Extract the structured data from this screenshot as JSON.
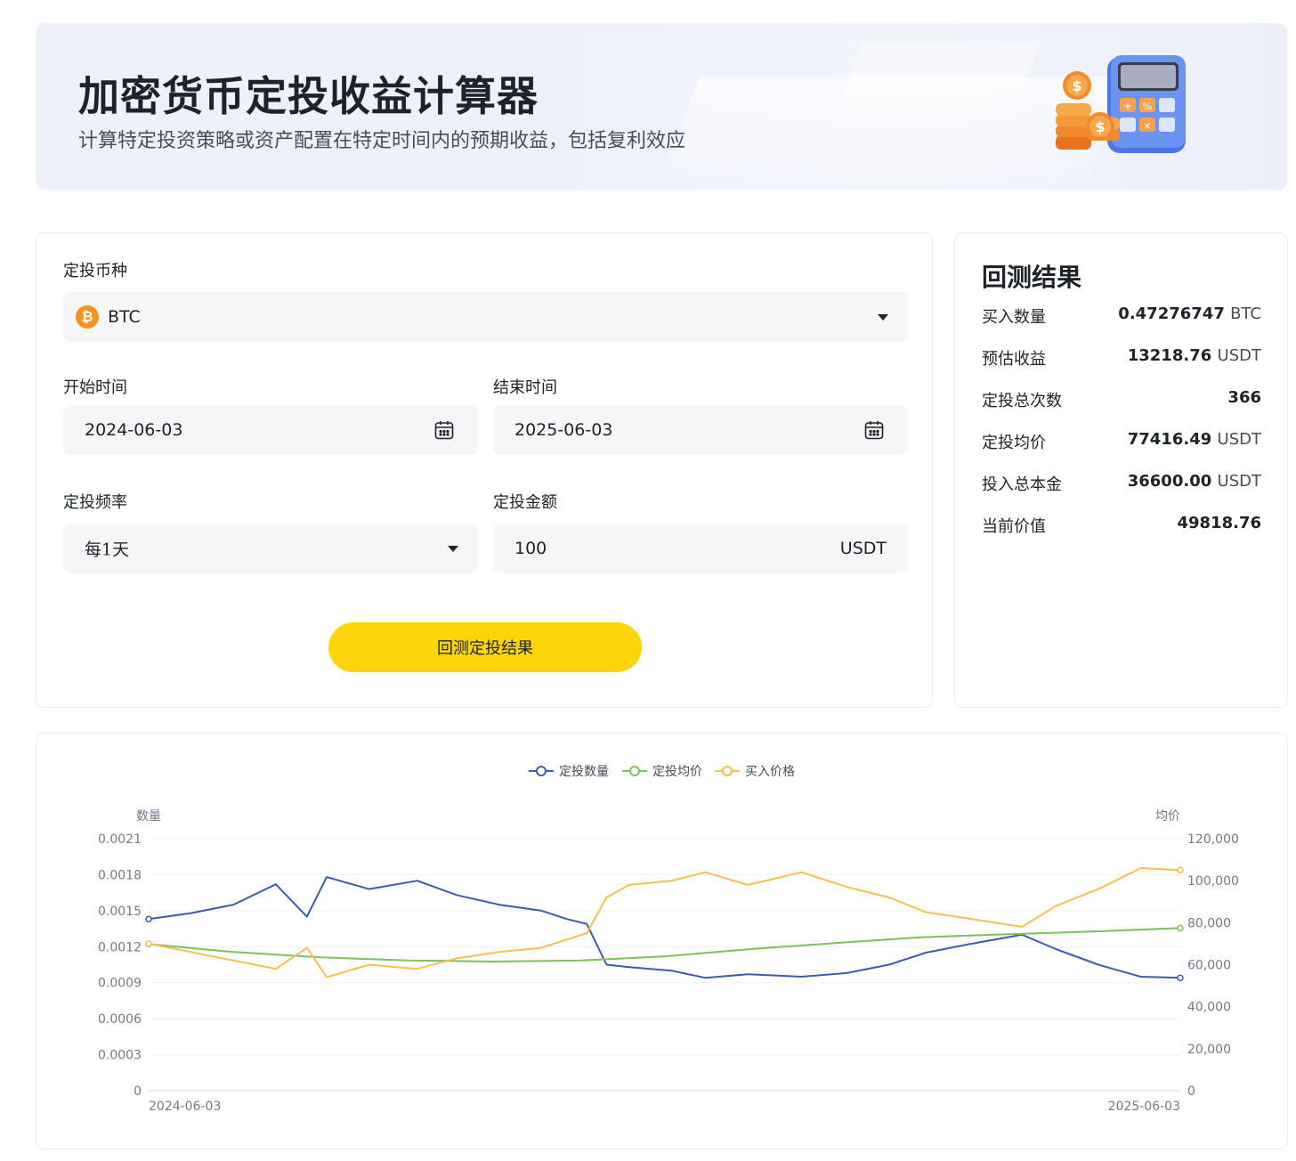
{
  "banner": {
    "title": "加密货币定投收益计算器",
    "subtitle": "计算特定投资策略或资产配置在特定时间内的预期收益，包括复利效应"
  },
  "form": {
    "coin_label": "定投币种",
    "coin_value": "BTC",
    "coin_icon_glyph": "₿",
    "start_label": "开始时间",
    "start_value": "2024-06-03",
    "end_label": "结束时间",
    "end_value": "2025-06-03",
    "freq_label": "定投频率",
    "freq_value": "每1天",
    "amount_label": "定投金额",
    "amount_value": "100",
    "amount_unit": "USDT",
    "submit_label": "回测定投结果"
  },
  "results": {
    "title": "回测结果",
    "rows": [
      {
        "key": "买入数量",
        "value": "0.47276747",
        "unit": "BTC"
      },
      {
        "key": "预估收益",
        "value": "13218.76",
        "unit": "USDT"
      },
      {
        "key": "定投总次数",
        "value": "366",
        "unit": ""
      },
      {
        "key": "定投均价",
        "value": "77416.49",
        "unit": "USDT"
      },
      {
        "key": "投入总本金",
        "value": "36600.00",
        "unit": "USDT"
      },
      {
        "key": "当前价值",
        "value": "49818.76",
        "unit": ""
      }
    ]
  },
  "colors": {
    "accent_yellow": "#fcd50a",
    "btc_orange": "#f7931a",
    "series_quantity": "#3e5bad",
    "series_avg": "#7ec05f",
    "series_price": "#f2c14e"
  },
  "chart_data": {
    "type": "line",
    "legend_position": "top-center",
    "grid": true,
    "y_left_label": "数量",
    "y_right_label": "均价",
    "y_left_ticks": [
      "0",
      "0.0003",
      "0.0006",
      "0.0009",
      "0.0012",
      "0.0015",
      "0.0018",
      "0.0021"
    ],
    "y_right_ticks": [
      "0",
      "20,000",
      "40,000",
      "60,000",
      "80,000",
      "100,000",
      "120,000"
    ],
    "y_left_range": [
      0,
      0.0021
    ],
    "y_right_range": [
      0,
      120000
    ],
    "x_labels": [
      "2024-06-03",
      "2025-06-03"
    ],
    "x_range": [
      "2024-06-03",
      "2025-06-03"
    ],
    "series": [
      {
        "name": "定投数量",
        "axis": "left",
        "x": [
          "2024-06-03",
          "2024-06-18",
          "2024-07-03",
          "2024-07-18",
          "2024-07-29",
          "2024-08-05",
          "2024-08-20",
          "2024-09-06",
          "2024-09-20",
          "2024-10-05",
          "2024-10-20",
          "2024-10-29",
          "2024-11-05",
          "2024-11-12",
          "2024-11-20",
          "2024-12-05",
          "2024-12-17",
          "2025-01-01",
          "2025-01-20",
          "2025-02-05",
          "2025-02-20",
          "2025-03-05",
          "2025-03-20",
          "2025-04-08",
          "2025-04-20",
          "2025-05-05",
          "2025-05-20",
          "2025-06-03"
        ],
        "y": [
          0.00143,
          0.00148,
          0.00155,
          0.00172,
          0.00145,
          0.00178,
          0.00168,
          0.00175,
          0.00163,
          0.00155,
          0.0015,
          0.00143,
          0.00139,
          0.00105,
          0.00103,
          0.001,
          0.00094,
          0.00097,
          0.00095,
          0.00098,
          0.00105,
          0.00115,
          0.00122,
          0.0013,
          0.00118,
          0.00105,
          0.00095,
          0.00094
        ]
      },
      {
        "name": "定投均价",
        "axis": "right",
        "x": [
          "2024-06-03",
          "2024-07-03",
          "2024-08-03",
          "2024-09-03",
          "2024-10-03",
          "2024-11-03",
          "2024-12-03",
          "2025-01-03",
          "2025-02-03",
          "2025-03-03",
          "2025-04-03",
          "2025-05-03",
          "2025-06-03"
        ],
        "y": [
          69800,
          66000,
          63500,
          62000,
          61500,
          62000,
          64000,
          67500,
          70500,
          73000,
          74500,
          75800,
          77416
        ]
      },
      {
        "name": "买入价格",
        "axis": "right",
        "x": [
          "2024-06-03",
          "2024-06-18",
          "2024-07-03",
          "2024-07-18",
          "2024-07-29",
          "2024-08-05",
          "2024-08-20",
          "2024-09-06",
          "2024-09-20",
          "2024-10-05",
          "2024-10-20",
          "2024-10-29",
          "2024-11-05",
          "2024-11-12",
          "2024-11-20",
          "2024-12-05",
          "2024-12-17",
          "2025-01-01",
          "2025-01-20",
          "2025-02-05",
          "2025-02-20",
          "2025-03-05",
          "2025-03-20",
          "2025-04-08",
          "2025-04-20",
          "2025-05-05",
          "2025-05-20",
          "2025-06-03"
        ],
        "y": [
          70000,
          66000,
          62000,
          58000,
          68000,
          54000,
          60000,
          58000,
          63000,
          66000,
          68000,
          72000,
          75000,
          92000,
          98000,
          100000,
          104000,
          98000,
          104000,
          97000,
          92000,
          85000,
          82000,
          78000,
          88000,
          96000,
          106000,
          105000
        ]
      }
    ]
  }
}
